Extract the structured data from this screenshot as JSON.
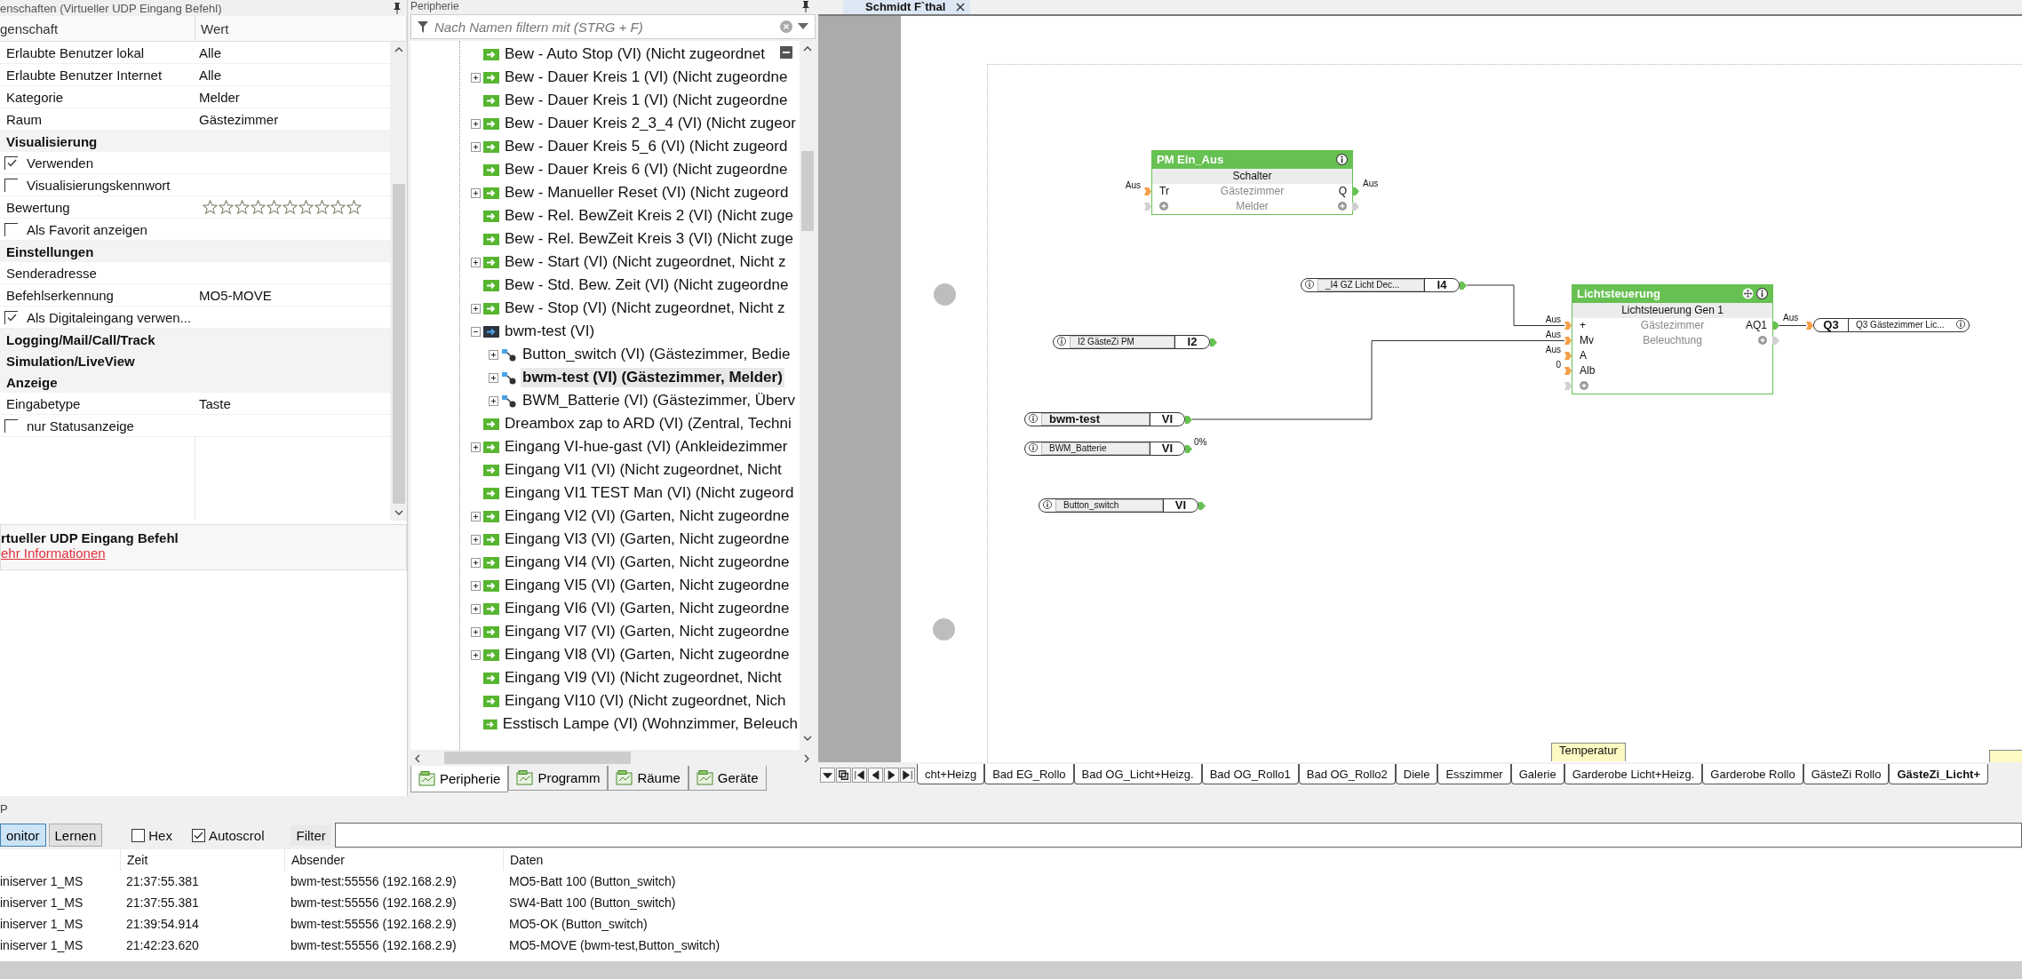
{
  "properties_panel": {
    "title": "enschaften (Virtueller UDP Eingang Befehl)",
    "column_headers": [
      "genschaft",
      "Wert"
    ],
    "rows": [
      {
        "kind": "field",
        "name": "Erlaubte Benutzer lokal",
        "value": "Alle"
      },
      {
        "kind": "field",
        "name": "Erlaubte Benutzer Internet",
        "value": "Alle"
      },
      {
        "kind": "field",
        "name": "Kategorie",
        "value": "Melder"
      },
      {
        "kind": "field",
        "name": "Raum",
        "value": "Gästezimmer"
      },
      {
        "kind": "section",
        "name": "Visualisierung"
      },
      {
        "kind": "checkbox",
        "name": "Verwenden",
        "checked": true
      },
      {
        "kind": "checkbox",
        "name": "Visualisierungskennwort",
        "checked": false
      },
      {
        "kind": "rating",
        "name": "Bewertung",
        "stars": 0
      },
      {
        "kind": "checkbox",
        "name": "Als Favorit anzeigen",
        "checked": false
      },
      {
        "kind": "section",
        "name": "Einstellungen"
      },
      {
        "kind": "field",
        "name": "Senderadresse"
      },
      {
        "kind": "field",
        "name": "Befehlserkennung",
        "value": "MO5-MOVE"
      },
      {
        "kind": "checkbox",
        "name": "Als Digitaleingang verwen...",
        "checked": true
      },
      {
        "kind": "section",
        "name": "Logging/Mail/Call/Track"
      },
      {
        "kind": "section",
        "name": "Simulation/LiveView"
      },
      {
        "kind": "section",
        "name": "Anzeige"
      },
      {
        "kind": "field",
        "name": "Eingabetype",
        "value": "Taste"
      },
      {
        "kind": "checkbox",
        "name": "nur Statusanzeige",
        "checked": false
      }
    ],
    "description": {
      "title": "rtueller UDP Eingang Befehl",
      "link": "ehr Informationen"
    }
  },
  "peripherals_panel": {
    "title": "Peripherie",
    "filter": {
      "placeholder": "Nach Namen filtern mit (STRG + F)"
    },
    "tree": [
      {
        "label": "Bew - Auto Stop (VI) (Nicht zugeordnet",
        "kind": "vi",
        "selected": false
      },
      {
        "label": "Bew - Dauer Kreis 1 (VI) (Nicht zugeordne",
        "kind": "vi",
        "expanded": false,
        "selected": false
      },
      {
        "label": "Bew - Dauer Kreis 1 (VI) (Nicht zugeordne",
        "kind": "vi",
        "selected": false
      },
      {
        "label": "Bew - Dauer Kreis 2_3_4 (VI) (Nicht zugeor",
        "kind": "vi",
        "expanded": false,
        "selected": false
      },
      {
        "label": "Bew - Dauer Kreis 5_6 (VI) (Nicht zugeord",
        "kind": "vi",
        "expanded": false,
        "selected": false
      },
      {
        "label": "Bew - Dauer Kreis 6 (VI) (Nicht zugeordne",
        "kind": "vi",
        "selected": false
      },
      {
        "label": "Bew - Manueller Reset (VI) (Nicht zugeord",
        "kind": "vi",
        "expanded": false,
        "selected": false
      },
      {
        "label": "Bew - Rel. BewZeit Kreis 2 (VI) (Nicht zuge",
        "kind": "vi",
        "selected": false
      },
      {
        "label": "Bew - Rel. BewZeit Kreis 3 (VI) (Nicht zuge",
        "kind": "vi",
        "selected": false
      },
      {
        "label": "Bew - Start (VI) (Nicht zugeordnet, Nicht z",
        "kind": "vi",
        "expanded": false,
        "selected": false
      },
      {
        "label": "Bew - Std. Bew. Zeit (VI) (Nicht zugeordne",
        "kind": "vi",
        "selected": false
      },
      {
        "label": "Bew - Stop (VI) (Nicht zugeordnet, Nicht z",
        "kind": "vi",
        "expanded": false,
        "selected": false
      },
      {
        "label": "bwm-test (VI)",
        "kind": "device",
        "expanded": true,
        "selected": false,
        "children": [
          {
            "label": "Button_switch (VI) (Gästezimmer, Bedie",
            "kind": "sensor",
            "expanded": false,
            "selected": false
          },
          {
            "label": "bwm-test (VI) (Gästezimmer, Melder)",
            "kind": "sensor",
            "expanded": false,
            "selected": true
          },
          {
            "label": "BWM_Batterie (VI) (Gästezimmer, Überv",
            "kind": "sensor",
            "expanded": false,
            "selected": false
          }
        ]
      },
      {
        "label": "Dreambox zap to ARD (VI) (Zentral, Techni",
        "kind": "vi",
        "selected": false
      },
      {
        "label": "Eingang VI-hue-gast (VI) (Ankleidezimmer",
        "kind": "vi",
        "expanded": false,
        "selected": false
      },
      {
        "label": "Eingang VI1 (VI) (Nicht zugeordnet, Nicht",
        "kind": "vi",
        "selected": false
      },
      {
        "label": "Eingang VI1 TEST Man (VI) (Nicht zugeord",
        "kind": "vi",
        "selected": false
      },
      {
        "label": "Eingang VI2 (VI) (Garten, Nicht zugeordne",
        "kind": "vi",
        "expanded": false,
        "selected": false
      },
      {
        "label": "Eingang VI3 (VI) (Garten, Nicht zugeordne",
        "kind": "vi",
        "expanded": false,
        "selected": false
      },
      {
        "label": "Eingang VI4 (VI) (Garten, Nicht zugeordne",
        "kind": "vi",
        "expanded": false,
        "selected": false
      },
      {
        "label": "Eingang VI5 (VI) (Garten, Nicht zugeordne",
        "kind": "vi",
        "expanded": false,
        "selected": false
      },
      {
        "label": "Eingang VI6 (VI) (Garten, Nicht zugeordne",
        "kind": "vi",
        "expanded": false,
        "selected": false
      },
      {
        "label": "Eingang VI7 (VI) (Garten, Nicht zugeordne",
        "kind": "vi",
        "expanded": false,
        "selected": false
      },
      {
        "label": "Eingang VI8 (VI) (Garten, Nicht zugeordne",
        "kind": "vi",
        "expanded": false,
        "selected": false
      },
      {
        "label": "Eingang VI9 (VI) (Nicht zugeordnet, Nicht",
        "kind": "vi",
        "selected": false
      },
      {
        "label": "Eingang VI10 (VI) (Nicht zugeordnet, Nich",
        "kind": "vi",
        "selected": false
      },
      {
        "label": "Esstisch Lampe (VI) (Wohnzimmer, Beleuch",
        "kind": "vi",
        "selected": false
      }
    ],
    "tabs": [
      {
        "label": "Peripherie",
        "selected": true
      },
      {
        "label": "Programm",
        "selected": false
      },
      {
        "label": "Räume",
        "selected": false
      },
      {
        "label": "Geräte",
        "selected": false
      }
    ]
  },
  "editor": {
    "document_tab": {
      "title": "Schmidt F`thal"
    },
    "blocks": [
      {
        "title": "PM Ein_Aus",
        "type": "Schalter",
        "room": "Gästezimmer",
        "category": "Melder",
        "movable": false,
        "inputs": [
          {
            "label": "Tr",
            "value": "Aus"
          }
        ],
        "outputs": [
          {
            "label": "Q",
            "value": "Aus"
          }
        ]
      },
      {
        "title": "Lichtsteuerung",
        "type": "Lichtsteuerung Gen 1",
        "room": "Gästezimmer",
        "category": "Beleuchtung",
        "movable": true,
        "inputs": [
          {
            "label": "+",
            "value": "Aus"
          },
          {
            "label": "Mv",
            "value": "Aus"
          },
          {
            "label": "A",
            "value": "Aus"
          },
          {
            "label": "Alb",
            "value": "0"
          }
        ],
        "outputs": [
          {
            "label": "AQ1",
            "value": "Aus"
          }
        ]
      }
    ],
    "references": [
      {
        "kind": "input",
        "label": "_I4 GZ Licht Dec...",
        "port": "I4",
        "selected": false
      },
      {
        "kind": "output",
        "label": "Q3 Gästezimmer Lic...",
        "port": "Q3",
        "selected": false
      },
      {
        "kind": "input",
        "label": "I2 GästeZi  PM",
        "port": "I2",
        "selected": false
      },
      {
        "kind": "input",
        "label": "bwm-test",
        "port": "VI",
        "selected": true
      },
      {
        "kind": "input",
        "label": "BWM_Batterie",
        "port": "VI",
        "value": "0%",
        "selected": false
      },
      {
        "kind": "input",
        "label": "Button_switch",
        "port": "VI",
        "selected": false
      }
    ],
    "note": "Temperatur",
    "sheet_tabs": [
      {
        "label": "cht+Heizg",
        "selected": false
      },
      {
        "label": "Bad EG_Rollo",
        "selected": false
      },
      {
        "label": "Bad OG_Licht+Heizg.",
        "selected": false
      },
      {
        "label": "Bad OG_Rollo1",
        "selected": false
      },
      {
        "label": "Bad OG_Rollo2",
        "selected": false
      },
      {
        "label": "Diele",
        "selected": false
      },
      {
        "label": "Esszimmer",
        "selected": false
      },
      {
        "label": "Galerie",
        "selected": false
      },
      {
        "label": "Garderobe Licht+Heizg.",
        "selected": false
      },
      {
        "label": "Garderobe Rollo",
        "selected": false
      },
      {
        "label": "GästeZi Rollo",
        "selected": false
      },
      {
        "label": "GästeZi_Licht+",
        "selected": true
      }
    ]
  },
  "udp_monitor": {
    "title": "P",
    "buttons": [
      {
        "label": "onitor",
        "selected": true
      },
      {
        "label": "Lernen",
        "selected": false
      }
    ],
    "options": [
      {
        "label": "Hex",
        "checked": false
      },
      {
        "label": "Autoscrol",
        "checked": true
      }
    ],
    "filter": {
      "label": "Filter"
    },
    "columns": [
      "",
      "Zeit",
      "Absender",
      "Daten"
    ],
    "rows": [
      [
        "iniserver 1_MS",
        "21:37:55.381",
        "bwm-test:55556 (192.168.2.9)",
        "MO5-Batt 100 (Button_switch)"
      ],
      [
        "iniserver 1_MS",
        "21:37:55.381",
        "bwm-test:55556 (192.168.2.9)",
        "SW4-Batt 100 (Button_switch)"
      ],
      [
        "iniserver 1_MS",
        "21:39:54.914",
        "bwm-test:55556 (192.168.2.9)",
        "MO5-OK (Button_switch)"
      ],
      [
        "iniserver 1_MS",
        "21:42:23.620",
        "bwm-test:55556 (192.168.2.9)",
        "MO5-MOVE (bwm-test,Button_switch)"
      ]
    ]
  }
}
